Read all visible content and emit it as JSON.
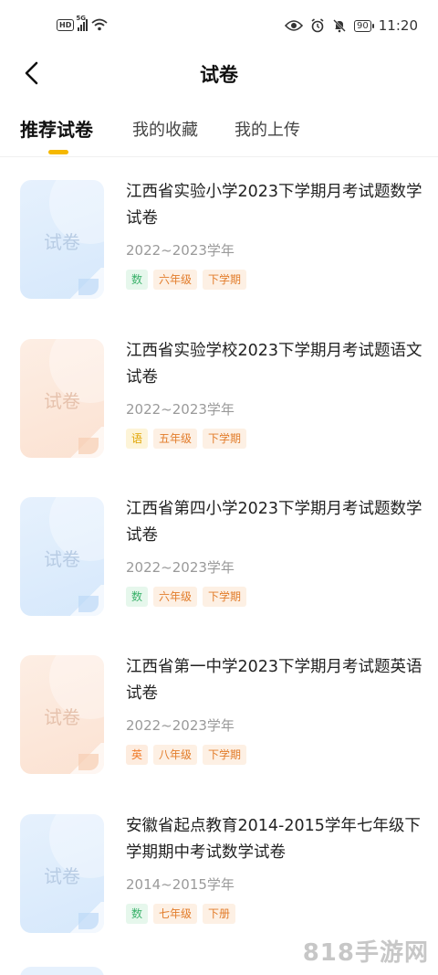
{
  "status_bar": {
    "hd": "HD",
    "network": "5G",
    "battery": "90",
    "time": "11:20"
  },
  "nav": {
    "title": "试卷"
  },
  "tabs": [
    {
      "label": "推荐试卷",
      "active": true
    },
    {
      "label": "我的收藏",
      "active": false
    },
    {
      "label": "我的上传",
      "active": false
    }
  ],
  "thumb_label": "试卷",
  "papers": [
    {
      "title": "江西省实验小学2023下学期月考试题数学试卷",
      "year": "2022~2023学年",
      "subject": "数",
      "grade": "六年级",
      "term": "下学期",
      "theme": "blue",
      "subject_style": "sub-green"
    },
    {
      "title": "江西省实验学校2023下学期月考试题语文试卷",
      "year": "2022~2023学年",
      "subject": "语",
      "grade": "五年级",
      "term": "下学期",
      "theme": "orange",
      "subject_style": "sub-yellow"
    },
    {
      "title": "江西省第四小学2023下学期月考试题数学试卷",
      "year": "2022~2023学年",
      "subject": "数",
      "grade": "六年级",
      "term": "下学期",
      "theme": "blue",
      "subject_style": "sub-green"
    },
    {
      "title": "江西省第一中学2023下学期月考试题英语试卷",
      "year": "2022~2023学年",
      "subject": "英",
      "grade": "八年级",
      "term": "下学期",
      "theme": "orange",
      "subject_style": "sub-orange"
    },
    {
      "title": "安徽省起点教育2014-2015学年七年级下学期期中考试数学试卷",
      "year": "2014~2015学年",
      "subject": "数",
      "grade": "七年级",
      "term": "下册",
      "theme": "blue",
      "subject_style": "sub-green"
    }
  ],
  "watermark": "818手游网",
  "colors": {
    "accent": "#f5b800",
    "tag_orange": "#e27c2a",
    "tag_green": "#3bb26b"
  }
}
